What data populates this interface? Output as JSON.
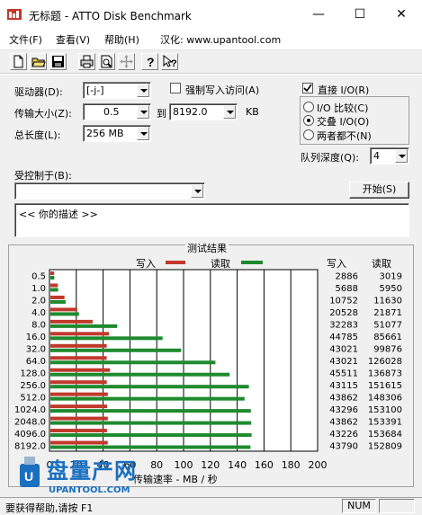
{
  "window": {
    "title": "无标题 - ATTO Disk Benchmark",
    "minimize": "—",
    "maximize": "☐",
    "close": "✕"
  },
  "menu": {
    "file": "文件(F)",
    "view": "查看(V)",
    "help": "帮助(H)",
    "localization": "汉化: www.upantool.com"
  },
  "toolbar": {
    "icons": [
      "new-document-icon",
      "open-folder-icon",
      "save-icon",
      "print-icon",
      "print-preview-icon",
      "move-icon",
      "help-icon",
      "context-help-icon"
    ]
  },
  "settings": {
    "drive_label": "驱动器(D):",
    "drive_value": "[-j-]",
    "force_write_label": "强制写入访问(A)",
    "direct_io_label": "直接 I/O(R)",
    "transfer_size_label": "传输大小(Z):",
    "transfer_from": "0.5",
    "transfer_to_label": "到",
    "transfer_to": "8192.0",
    "kb_label": "KB",
    "total_length_label": "总长度(L):",
    "total_length": "256 MB",
    "io_compare_label": "I/O 比较(C)",
    "overlapped_io_label": "交叠 I/O(O)",
    "neither_label": "两者都不(N)",
    "queue_depth_label": "队列深度(Q):",
    "queue_depth": "4",
    "controlled_by_label": "受控制于(B):",
    "controlled_by_value": "",
    "start_button": "开始(S)",
    "description": "<<  你的描述   >>"
  },
  "chart_data": {
    "type": "bar",
    "title": "测试结果",
    "legend_write": "写入",
    "legend_read": "读取",
    "col_write": "写入",
    "col_read": "读取",
    "write_color": "#c0392b",
    "read_color": "#1e8a2e",
    "xlabel": "传输速率 - MB / 秒",
    "xlim": [
      0,
      200
    ],
    "xticks": [
      "0",
      "20",
      "40",
      "60",
      "80",
      "100",
      "120",
      "140",
      "160",
      "180",
      "200"
    ],
    "categories": [
      "0.5",
      "1.0",
      "2.0",
      "4.0",
      "8.0",
      "16.0",
      "32.0",
      "64.0",
      "128.0",
      "256.0",
      "512.0",
      "1024.0",
      "2048.0",
      "4096.0",
      "8192.0"
    ],
    "series": [
      {
        "name": "写入",
        "values": [
          2886,
          5688,
          10752,
          20528,
          32283,
          44785,
          43021,
          43021,
          45511,
          43115,
          43862,
          43296,
          43862,
          43226,
          43790
        ]
      },
      {
        "name": "读取",
        "values": [
          3019,
          5950,
          11630,
          21871,
          51077,
          85661,
          99876,
          126028,
          136873,
          151615,
          148306,
          153100,
          153391,
          153684,
          152809
        ]
      }
    ]
  },
  "status": {
    "help_text": "要获得帮助,请按 F1",
    "num": "NUM"
  },
  "watermark": {
    "text": "盘量产网",
    "url": "UPANTOOL.COM"
  }
}
